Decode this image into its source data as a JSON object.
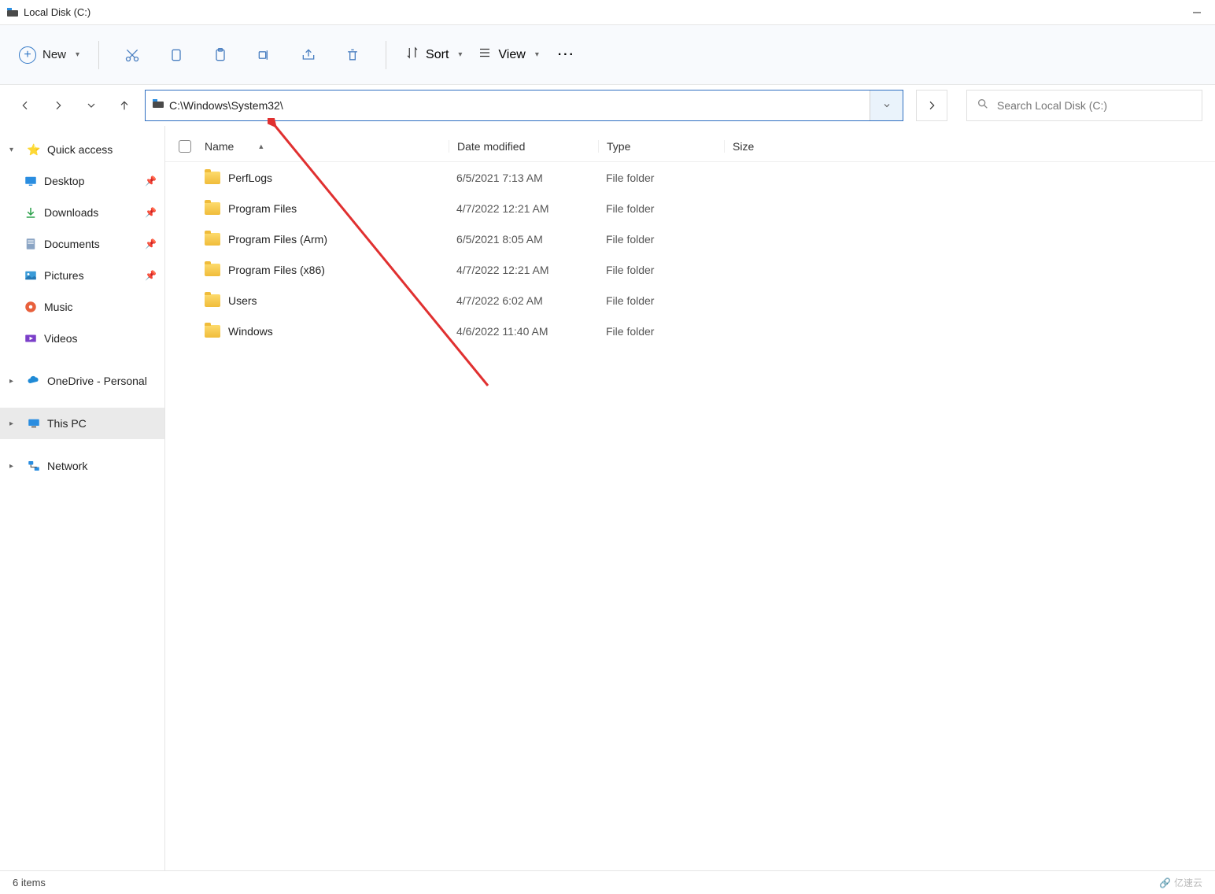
{
  "window": {
    "title": "Local Disk (C:)"
  },
  "toolbar": {
    "new_label": "New",
    "sort_label": "Sort",
    "view_label": "View"
  },
  "nav": {
    "address": "C:\\Windows\\System32\\",
    "search_placeholder": "Search Local Disk (C:)"
  },
  "sidebar": {
    "quick_access": "Quick access",
    "items": [
      {
        "label": "Desktop"
      },
      {
        "label": "Downloads"
      },
      {
        "label": "Documents"
      },
      {
        "label": "Pictures"
      },
      {
        "label": "Music"
      },
      {
        "label": "Videos"
      }
    ],
    "onedrive": "OneDrive - Personal",
    "this_pc": "This PC",
    "network": "Network"
  },
  "columns": {
    "name": "Name",
    "date": "Date modified",
    "type": "Type",
    "size": "Size"
  },
  "files": [
    {
      "name": "PerfLogs",
      "date": "6/5/2021 7:13 AM",
      "type": "File folder"
    },
    {
      "name": "Program Files",
      "date": "4/7/2022 12:21 AM",
      "type": "File folder"
    },
    {
      "name": "Program Files (Arm)",
      "date": "6/5/2021 8:05 AM",
      "type": "File folder"
    },
    {
      "name": "Program Files (x86)",
      "date": "4/7/2022 12:21 AM",
      "type": "File folder"
    },
    {
      "name": "Users",
      "date": "4/7/2022 6:02 AM",
      "type": "File folder"
    },
    {
      "name": "Windows",
      "date": "4/6/2022 11:40 AM",
      "type": "File folder"
    }
  ],
  "status": {
    "text": "6 items"
  },
  "watermark": "亿速云"
}
